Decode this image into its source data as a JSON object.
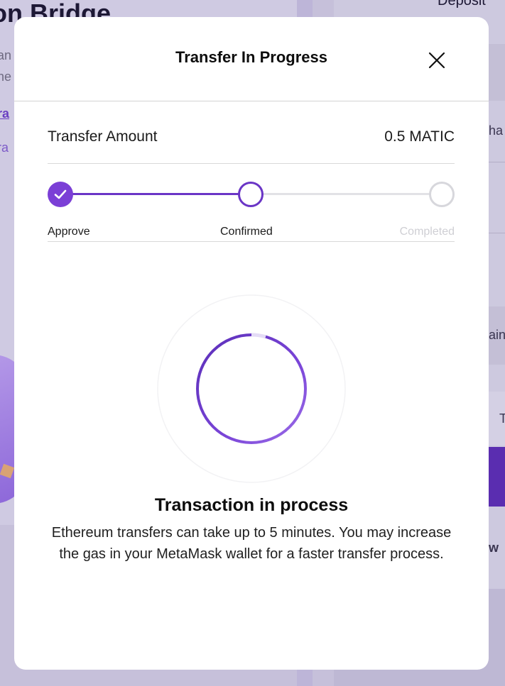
{
  "background": {
    "page_title": "on Bridge",
    "text_line1": "an",
    "text_line2": "he",
    "link1": "ra",
    "link2": "ra",
    "deposit_label": "Deposit",
    "right_text1": "ha",
    "right_text2": "ain",
    "right_text3": "T",
    "right_text4": "w"
  },
  "modal": {
    "title": "Transfer In Progress",
    "close_icon": "close-icon",
    "transfer_amount_label": "Transfer Amount",
    "transfer_amount_value": "0.5 MATIC",
    "steps": [
      {
        "label": "Approve",
        "state": "done"
      },
      {
        "label": "Confirmed",
        "state": "active"
      },
      {
        "label": "Completed",
        "state": "pending"
      }
    ],
    "status_title": "Transaction in process",
    "status_description": "Ethereum transfers can take up to 5 minutes. You may increase the gas in your MetaMask wallet for a faster transfer process."
  },
  "colors": {
    "accent": "#7b3fd6",
    "accent_dark": "#6a35c6",
    "inactive": "#d7d7dc"
  }
}
